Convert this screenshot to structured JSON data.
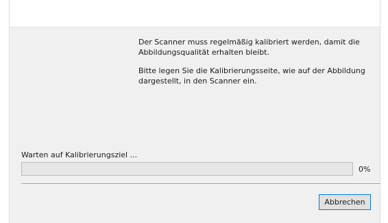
{
  "dialog": {
    "instructions": [
      "Der Scanner muss regelmäßig kalibriert werden, damit die Abbildungsqualität erhalten bleibt.",
      "Bitte legen Sie die Kalibrierungsseite, wie auf der Abbildung dargestellt, in den Scanner ein."
    ],
    "status_text": "Warten auf Kalibrierungsziel ...",
    "progress": {
      "value": 0,
      "label": "0%"
    },
    "cancel_label": "Abbrechen"
  },
  "colors": {
    "accent": "#0078d7",
    "dialog_background": "#f0f0f0",
    "progress_fill": "#06b025"
  }
}
